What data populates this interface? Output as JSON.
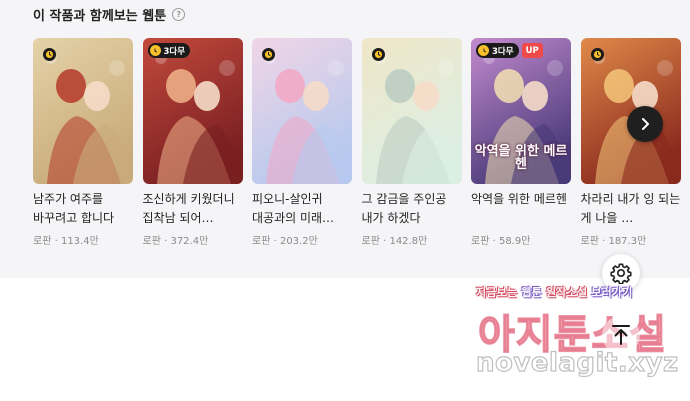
{
  "section": {
    "title": "이 작품과 함께보는 웹툰",
    "help_icon": "question-circle-icon"
  },
  "cards": [
    {
      "id": "card-1",
      "title": "남주가 여주를 바꾸려고 합니다",
      "cover_text": "",
      "genre": "로판",
      "views": "113.4만",
      "badges": {
        "clock": true,
        "free_days": "",
        "up": ""
      },
      "palette": {
        "bg1": "#c9ab7a",
        "bg2": "#e4d2a8",
        "accent": "#b53a2a"
      }
    },
    {
      "id": "card-2",
      "title": "조신하게 키웠더니 집착남 되어…",
      "cover_text": "",
      "genre": "로판",
      "views": "372.4만",
      "badges": {
        "clock": false,
        "free_days": "3다무",
        "up": ""
      },
      "palette": {
        "bg1": "#7a1f22",
        "bg2": "#c24a3c",
        "accent": "#f0b48a"
      }
    },
    {
      "id": "card-3",
      "title": "피오니-살인귀 대공과의 미래…",
      "cover_text": "",
      "genre": "로판",
      "views": "203.2만",
      "badges": {
        "clock": true,
        "free_days": "",
        "up": ""
      },
      "palette": {
        "bg1": "#b7c9ee",
        "bg2": "#f1d5e6",
        "accent": "#f3a7c4"
      }
    },
    {
      "id": "card-4",
      "title": "그 감금을 주인공 내가 하겠다",
      "cover_text": "",
      "genre": "로판",
      "views": "142.8만",
      "badges": {
        "clock": true,
        "free_days": "",
        "up": ""
      },
      "palette": {
        "bg1": "#dcefe3",
        "bg2": "#f0e6c8",
        "accent": "#b9cbbf"
      }
    },
    {
      "id": "card-5",
      "title": "악역을 위한 메르헨",
      "cover_text": "악역을 위한 메르헨",
      "genre": "로판",
      "views": "58.9만",
      "badges": {
        "clock": false,
        "free_days": "3다무",
        "up": "UP"
      },
      "palette": {
        "bg1": "#4a3a78",
        "bg2": "#c38bcf",
        "accent": "#f2e0b0"
      }
    },
    {
      "id": "card-6",
      "title": "차라리 내가 잉 되는 게 나을 …",
      "cover_text": "",
      "genre": "로판",
      "views": "187.3만",
      "badges": {
        "clock": true,
        "free_days": "",
        "up": ""
      },
      "palette": {
        "bg1": "#8a2a1e",
        "bg2": "#e08a4a",
        "accent": "#f4c67a"
      }
    }
  ],
  "controls": {
    "next_icon": "chevron-right-icon",
    "settings_icon": "gear-icon",
    "top_icon": "arrow-up-icon"
  },
  "watermark": {
    "line1_a": "지금보는 ",
    "line1_b": "웹툰",
    "line1_c": " 원작소설 ",
    "line1_d": "보러가기",
    "line2": "아지툰소설",
    "line3": "novelagit.xyz"
  }
}
